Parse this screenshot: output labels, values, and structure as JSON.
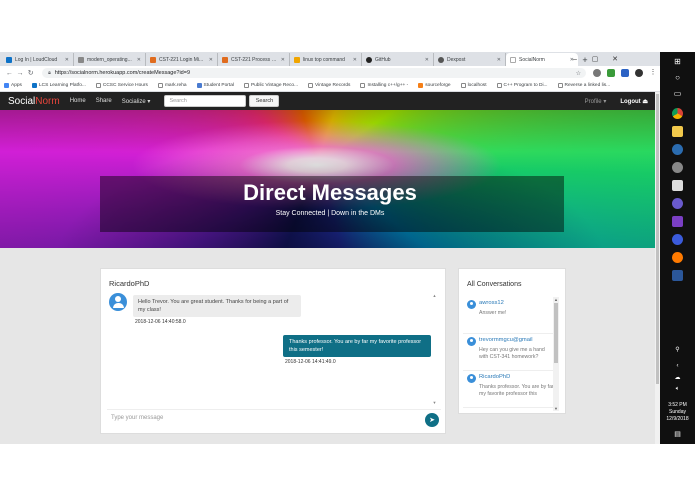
{
  "browser": {
    "tabs": [
      {
        "label": "Log In | LoudCloud",
        "color": "#0e72c7"
      },
      {
        "label": "modern_operating...",
        "color": "#888888"
      },
      {
        "label": "CST-221 Login Mi...",
        "color": "#e06c1f"
      },
      {
        "label": "CST-221 Process Li...",
        "color": "#e06c1f"
      },
      {
        "label": "linux top command",
        "color": "#f0a500"
      },
      {
        "label": "GitHub",
        "color": "#222222"
      },
      {
        "label": "Dexpost",
        "color": "#555555"
      },
      {
        "label": "SocialNorm",
        "color": "#cccccc"
      }
    ],
    "active_tab_index": 7,
    "new_tab": "+",
    "url": "https://socialnorm.herokuapp.com/createMessage?id=9",
    "window_controls": [
      "–",
      "▢",
      "✕"
    ],
    "bookmarks": [
      {
        "label": "Apps",
        "color": "#4285f4"
      },
      {
        "label": "LCS Learning Platfo...",
        "color": "#0e72c7"
      },
      {
        "label": "CCSC Service Hours",
        "color": "#777777"
      },
      {
        "label": "mark.reha",
        "color": "#777777"
      },
      {
        "label": "Student Portal",
        "color": "#4a7bd0"
      },
      {
        "label": "Public Vintage Reco...",
        "color": "#777777"
      },
      {
        "label": "Vintage Records",
        "color": "#777777"
      },
      {
        "label": "Installing c++/g++ -",
        "color": "#777777"
      },
      {
        "label": "sourceforge",
        "color": "#f57f17"
      },
      {
        "label": "localhost",
        "color": "#777777"
      },
      {
        "label": "C++ Program to Di...",
        "color": "#777777"
      },
      {
        "label": "Reverse a linked lis...",
        "color": "#777777"
      }
    ]
  },
  "site": {
    "brand_social": "Social",
    "brand_norm": "Norm",
    "nav_home": "Home",
    "nav_share": "Share",
    "nav_socialize": "Socialize ▾",
    "search_placeholder": "Search",
    "search_button": "Search",
    "profile": "Profile ▾",
    "logout": "Logout"
  },
  "hero": {
    "title": "Direct Messages",
    "subtitle": "Stay Connected | Down in the DMs"
  },
  "chat": {
    "header": "RicardoPhD",
    "messages": [
      {
        "text": "Hello Trevor. You are great student. Thanks for being a part of my class!",
        "time": "2018-12-06 14:40:58.0",
        "direction": "in"
      },
      {
        "text": "Thanks professor. You are by far my favorite professor this semester!",
        "time": "2018-12-06 14:41:49.0",
        "direction": "out"
      }
    ],
    "composer_placeholder": "Type your message"
  },
  "conversations": {
    "title": "All Conversations",
    "items": [
      {
        "name": "awross12",
        "preview": "Answer me!"
      },
      {
        "name": "trevormmgcu@gmail",
        "preview": "Hey can you give me a hand with CST-341 homework?"
      },
      {
        "name": "RicardoPhD",
        "preview": "Thanks professor. You are by far my favorite professor this"
      }
    ]
  },
  "taskbar": {
    "time": "3:52 PM",
    "day": "Sunday",
    "date": "12/9/2018"
  }
}
